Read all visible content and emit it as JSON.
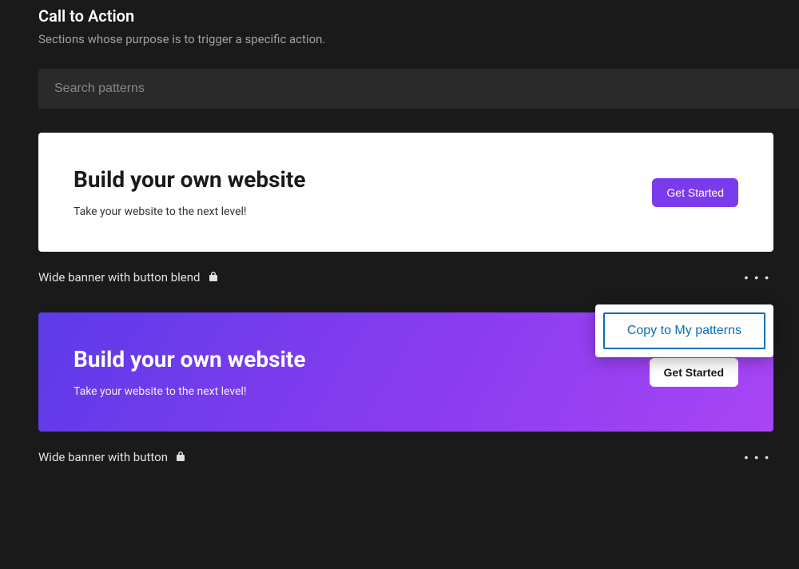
{
  "header": {
    "title": "Call to Action",
    "subtitle": "Sections whose purpose is to trigger a specific action."
  },
  "search": {
    "placeholder": "Search patterns"
  },
  "patterns": [
    {
      "heading": "Build your own website",
      "sub": "Take your website to the next level!",
      "button": "Get Started",
      "label": "Wide banner with button blend"
    },
    {
      "heading": "Build your own website",
      "sub": "Take your website to the next level!",
      "button": "Get Started",
      "label": "Wide banner with button"
    }
  ],
  "menu": {
    "copy": "Copy to My patterns"
  },
  "more_glyph": "• • •"
}
